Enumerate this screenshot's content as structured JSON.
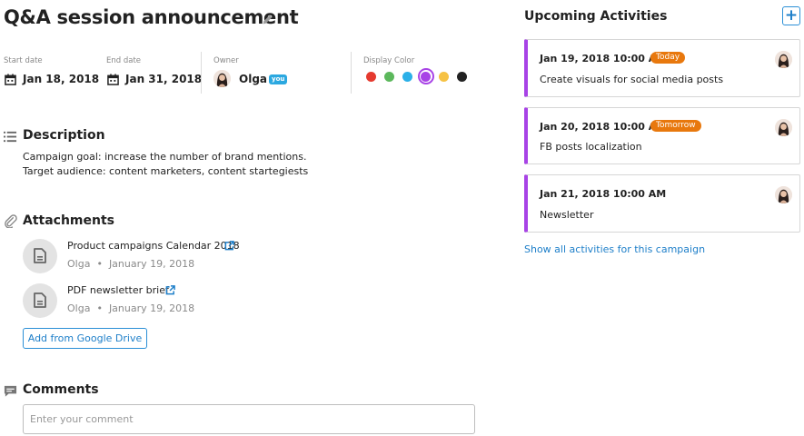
{
  "header": {
    "title": "Q&A session announcement"
  },
  "meta": {
    "start_label": "Start date",
    "start_value": "Jan 18, 2018",
    "end_label": "End date",
    "end_value": "Jan 31, 2018",
    "owner_label": "Owner",
    "owner_name": "Olga",
    "owner_badge": "you",
    "color_label": "Display Color",
    "colors": [
      "#e53a2f",
      "#5cb85c",
      "#2bb0e8",
      "#a843e6",
      "#f6c244",
      "#222222"
    ],
    "selected_color": "#a843e6"
  },
  "description": {
    "title": "Description",
    "lines": [
      "Campaign goal: increase the number of brand mentions.",
      "Target audience: content marketers, content startegiests"
    ]
  },
  "attachments": {
    "title": "Attachments",
    "items": [
      {
        "name": "Product campaigns Calendar 2018",
        "author": "Olga",
        "date": "January 19, 2018"
      },
      {
        "name": "PDF newsletter brief",
        "author": "Olga",
        "date": "January 19, 2018"
      }
    ],
    "bullet": "•",
    "add_button": "Add from Google Drive"
  },
  "comments": {
    "title": "Comments",
    "placeholder": "Enter your comment"
  },
  "upcoming": {
    "title": "Upcoming Activities",
    "add_label": "+",
    "cards": [
      {
        "date": "Jan 19, 2018 10:00 AM",
        "badge": "Today",
        "text": "Create visuals for social media posts"
      },
      {
        "date": "Jan 20, 2018 10:00 AM",
        "badge": "Tomorrow",
        "text": "FB posts localization"
      },
      {
        "date": "Jan 21, 2018 10:00 AM",
        "badge": "",
        "text": "Newsletter"
      }
    ],
    "link": "Show all activities for this campaign"
  }
}
